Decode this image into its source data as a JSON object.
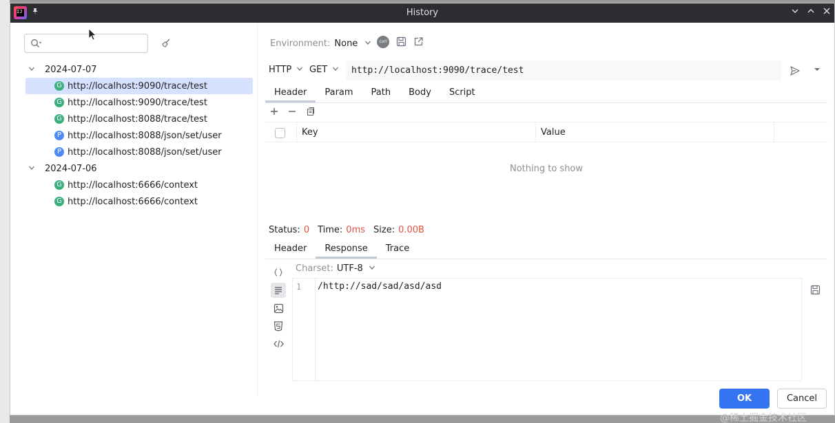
{
  "window": {
    "title": "History",
    "app_logo_text": "IJ"
  },
  "sidebar": {
    "search": {
      "value": "",
      "placeholder": ""
    },
    "groups": [
      {
        "date": "2024-07-07",
        "items": [
          {
            "method": "G",
            "url": "http://localhost:9090/trace/test",
            "selected": true
          },
          {
            "method": "G",
            "url": "http://localhost:9090/trace/test",
            "selected": false
          },
          {
            "method": "G",
            "url": "http://localhost:8088/trace/test",
            "selected": false
          },
          {
            "method": "P",
            "url": "http://localhost:8088/json/set/user",
            "selected": false
          },
          {
            "method": "P",
            "url": "http://localhost:8088/json/set/user",
            "selected": false
          }
        ]
      },
      {
        "date": "2024-07-06",
        "items": [
          {
            "method": "G",
            "url": "http://localhost:6666/context",
            "selected": false
          },
          {
            "method": "G",
            "url": "http://localhost:6666/context",
            "selected": false
          }
        ]
      }
    ]
  },
  "environment": {
    "label": "Environment:",
    "value": "None",
    "curl_label": "curl"
  },
  "request": {
    "protocol": "HTTP",
    "method": "GET",
    "url": "http://localhost:9090/trace/test",
    "tabs": [
      "Header",
      "Param",
      "Path",
      "Body",
      "Script"
    ],
    "active_tab": "Header",
    "table": {
      "col_key": "Key",
      "col_value": "Value",
      "empty_text": "Nothing to show"
    }
  },
  "response": {
    "status_label": "Status:",
    "status_value": "0",
    "time_label": "Time:",
    "time_value": "0ms",
    "size_label": "Size:",
    "size_value": "0.00B",
    "tabs": [
      "Header",
      "Response",
      "Trace"
    ],
    "active_tab": "Response",
    "charset_label": "Charset:",
    "charset_value": "UTF-8",
    "line_number": "1",
    "body_text": "/http://sad/sad/asd/asd"
  },
  "buttons": {
    "ok": "OK",
    "cancel": "Cancel"
  },
  "watermark": "@稀土掘金技术社区",
  "colors": {
    "accent": "#3574f0",
    "selected_row": "#d5e1ff",
    "get_badge": "#3bb07d",
    "post_badge": "#4a8bf5",
    "status_value": "#e0513f",
    "titlebar": "#2b2d30"
  }
}
